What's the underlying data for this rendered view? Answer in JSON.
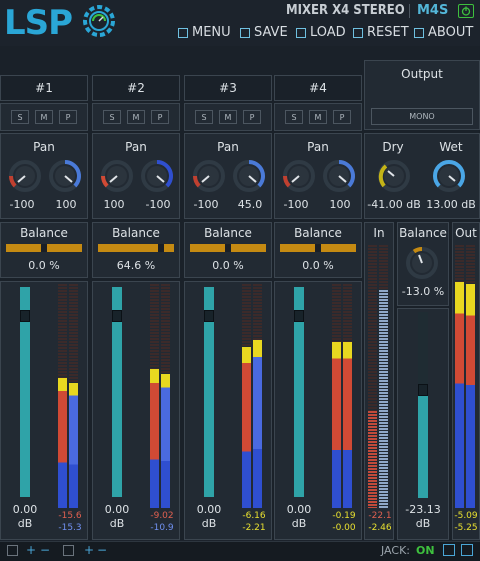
{
  "header": {
    "logo": "LSP",
    "plugin_title": "MIXER X4 STEREO",
    "plugin_code": "M4S"
  },
  "menu": {
    "menu_label": "MENU",
    "save_label": "SAVE",
    "load_label": "LOAD",
    "reset_label": "RESET",
    "about_label": "ABOUT"
  },
  "channels": [
    {
      "name": "#1",
      "pan_label": "Pan",
      "pan_l": "-100",
      "pan_r": "100",
      "balance_label": "Balance",
      "balance": "0.0 %",
      "fader_db": "0.00",
      "db_unit": "dB",
      "meter_l": "-15.6",
      "meter_r": "-15.3"
    },
    {
      "name": "#2",
      "pan_label": "Pan",
      "pan_l": "100",
      "pan_r": "-100",
      "balance_label": "Balance",
      "balance": "64.6 %",
      "fader_db": "0.00",
      "db_unit": "dB",
      "meter_l": "-9.02",
      "meter_r": "-10.9"
    },
    {
      "name": "#3",
      "pan_label": "Pan",
      "pan_l": "-100",
      "pan_r": "45.0",
      "balance_label": "Balance",
      "balance": "0.0 %",
      "fader_db": "0.00",
      "db_unit": "dB",
      "meter_l": "-6.16",
      "meter_r": "-2.21"
    },
    {
      "name": "#4",
      "pan_label": "Pan",
      "pan_l": "-100",
      "pan_r": "100",
      "balance_label": "Balance",
      "balance": "0.0 %",
      "fader_db": "0.00",
      "db_unit": "dB",
      "meter_l": "-0.19",
      "meter_r": "-0.00"
    }
  ],
  "smp_buttons": [
    "S",
    "M",
    "P"
  ],
  "output": {
    "title": "Output",
    "mono_label": "MONO",
    "dry_label": "Dry",
    "wet_label": "Wet",
    "dry_value": "-41.00 dB",
    "wet_value": "13.00 dB",
    "in_label": "In",
    "out_label": "Out",
    "balance_label": "Balance",
    "balance_value": "-13.0 %",
    "fader_db": "-23.13",
    "db_unit": "dB",
    "in_meter_l": "-22.1",
    "in_meter_r": "-2.46",
    "out_meter_l": "-5.09",
    "out_meter_r": "-5.25"
  },
  "statusbar": {
    "jack_label": "JACK:",
    "jack_state": "ON"
  }
}
